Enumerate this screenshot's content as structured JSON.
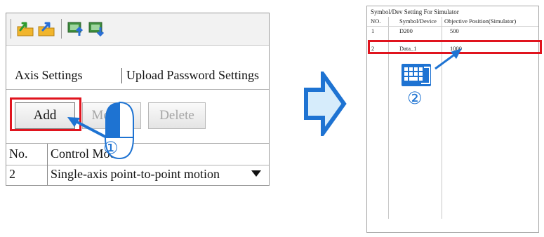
{
  "left_panel": {
    "toolbar": {
      "icons": [
        "import-program-icon",
        "export-program-icon",
        "upload-to-device-icon",
        "download-to-pc-icon"
      ]
    },
    "tabs": [
      {
        "label": "Axis Settings"
      },
      {
        "label": "Upload Password Settings"
      }
    ],
    "buttons": {
      "add": "Add",
      "modify": "Modify",
      "delete": "Delete"
    },
    "table": {
      "headers": [
        "No.",
        "Control Mode"
      ],
      "rows": [
        {
          "no": "2",
          "mode": "Single-axis point-to-point motion"
        }
      ]
    }
  },
  "right_panel": {
    "title": "Symbol/Dev Setting For Simulator",
    "headers": [
      "NO.",
      "Symbol/Device",
      "Objective Position(Simulator)"
    ],
    "rows": [
      {
        "no": "1",
        "symbol": "D200",
        "position": "500"
      },
      {
        "no": "2",
        "symbol": "Data_1",
        "position": "1000"
      }
    ]
  },
  "annotations": {
    "step1": "①",
    "step2": "②",
    "accent_color": "#1e73d2",
    "highlight_color": "#e0141e"
  }
}
